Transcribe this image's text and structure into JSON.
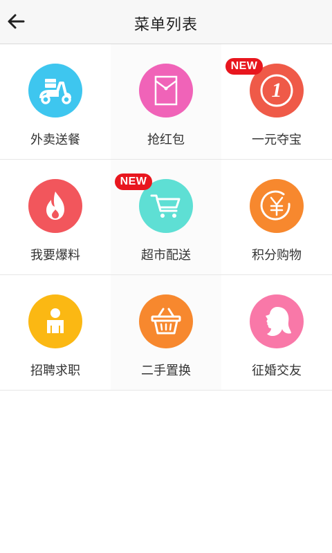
{
  "header": {
    "title": "菜单列表",
    "back_icon": "arrow-left-icon"
  },
  "menu": {
    "items": [
      {
        "label": "外卖送餐",
        "icon": "scooter-icon",
        "color": "#3ec6ef",
        "badge": ""
      },
      {
        "label": "抢红包",
        "icon": "envelope-icon",
        "color": "#f063b8",
        "badge": ""
      },
      {
        "label": "一元夺宝",
        "icon": "coin-one-icon",
        "color": "#ef5a48",
        "badge": "NEW"
      },
      {
        "label": "我要爆料",
        "icon": "flame-icon",
        "color": "#f2565c",
        "badge": ""
      },
      {
        "label": "超市配送",
        "icon": "shopping-cart-icon",
        "color": "#5edfd4",
        "badge": "NEW"
      },
      {
        "label": "积分购物",
        "icon": "yuan-coin-icon",
        "color": "#f7882e",
        "badge": ""
      },
      {
        "label": "招聘求职",
        "icon": "person-icon",
        "color": "#fbb813",
        "badge": ""
      },
      {
        "label": "二手置换",
        "icon": "basket-icon",
        "color": "#f7882e",
        "badge": ""
      },
      {
        "label": "征婚交友",
        "icon": "woman-profile-icon",
        "color": "#f978a8",
        "badge": ""
      }
    ]
  }
}
